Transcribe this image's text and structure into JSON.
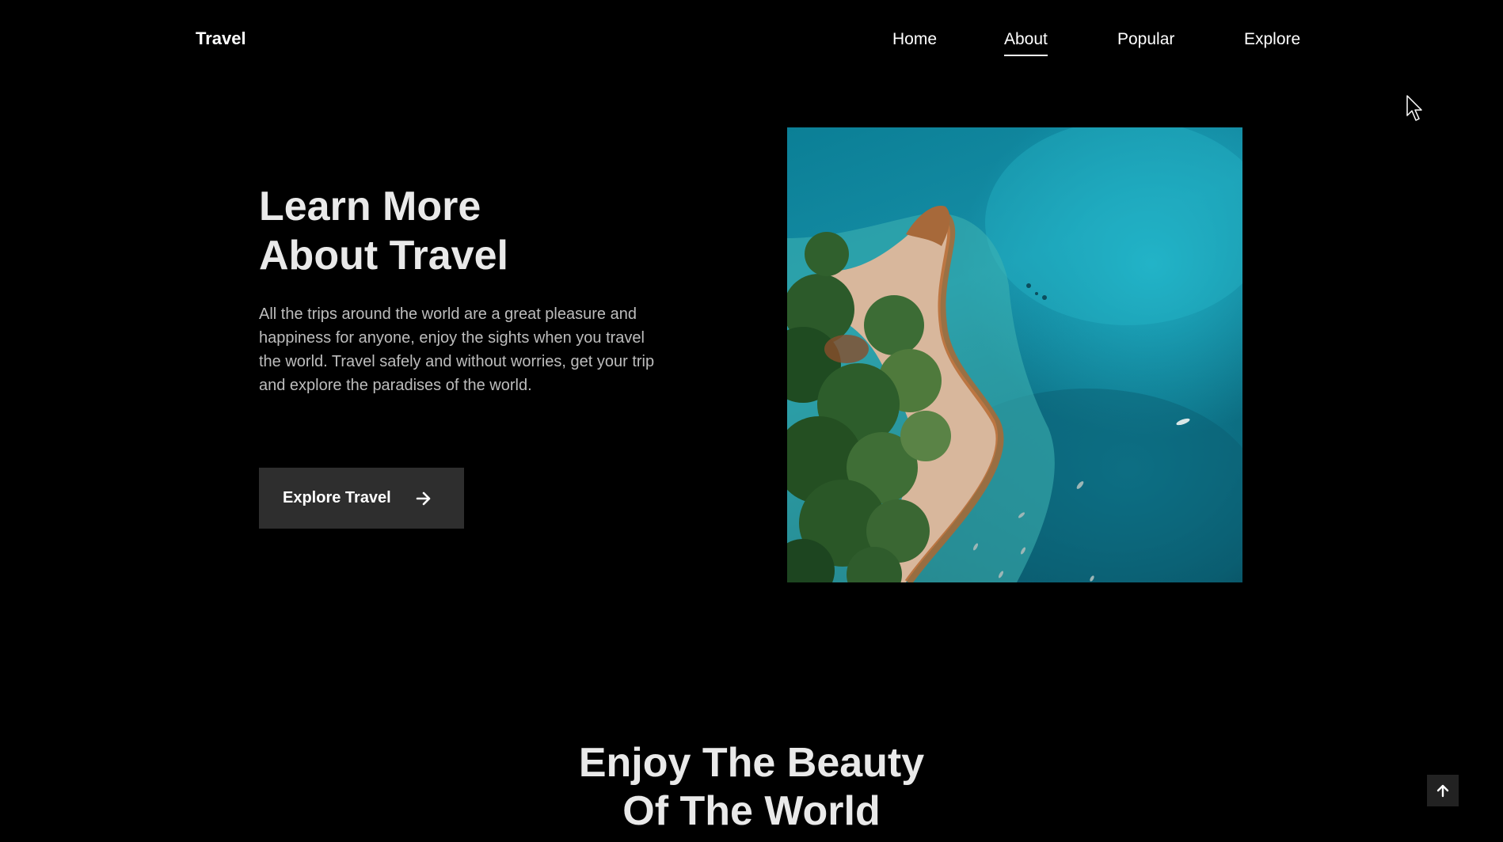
{
  "header": {
    "logo": "Travel",
    "nav": [
      {
        "label": "Home",
        "active": false
      },
      {
        "label": "About",
        "active": true
      },
      {
        "label": "Popular",
        "active": false
      },
      {
        "label": "Explore",
        "active": false
      }
    ]
  },
  "hero": {
    "title_line1": "Learn More",
    "title_line2": "About Travel",
    "description": "All the trips around the world are a great pleasure and happiness for anyone, enjoy the sights when you travel the world. Travel safely and without worries, get your trip and explore the paradises of the world.",
    "button_label": "Explore Travel",
    "button_icon": "arrow-right-icon",
    "image": "aerial-beach-island-photo"
  },
  "section": {
    "title_line1": "Enjoy The Beauty",
    "title_line2": "Of The World"
  },
  "scroll_up": {
    "icon": "arrow-up-icon"
  },
  "colors": {
    "background": "#000000",
    "text": "#ffffff",
    "button_bg": "#2e2e2e",
    "muted_text": "#bdbdbd"
  }
}
